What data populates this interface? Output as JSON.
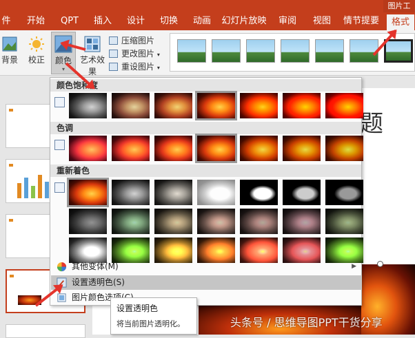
{
  "ribbon_tabs": [
    "件",
    "开始",
    "QPT",
    "插入",
    "设计",
    "切换",
    "动画",
    "幻灯片放映",
    "审阅",
    "视图",
    "情节提要",
    "格式"
  ],
  "ribbon": {
    "remove_bg": "背景",
    "corrections": "校正",
    "color": "颜色",
    "artistic_effects": "艺术效果",
    "compress": "压缩图片",
    "change_picture": "更改图片",
    "reset_picture": "重设图片",
    "format_tab_top": "图片工"
  },
  "dropdown": {
    "saturation_header": "颜色饱和度",
    "tone_header": "色调",
    "recolor_header": "重新着色",
    "more_variations": "其他变体(M)",
    "set_transparent": "设置透明色(S)",
    "color_options": "图片颜色选项(C)..."
  },
  "tooltip": {
    "title": "设置透明色",
    "description": "将当前图片透明化。"
  },
  "slide": {
    "title_fragment": "题"
  },
  "watermark": "头条号 / 思维导图PPT干货分享",
  "colors": {
    "accent": "#c43e1c",
    "arrow": "#e4342c"
  }
}
